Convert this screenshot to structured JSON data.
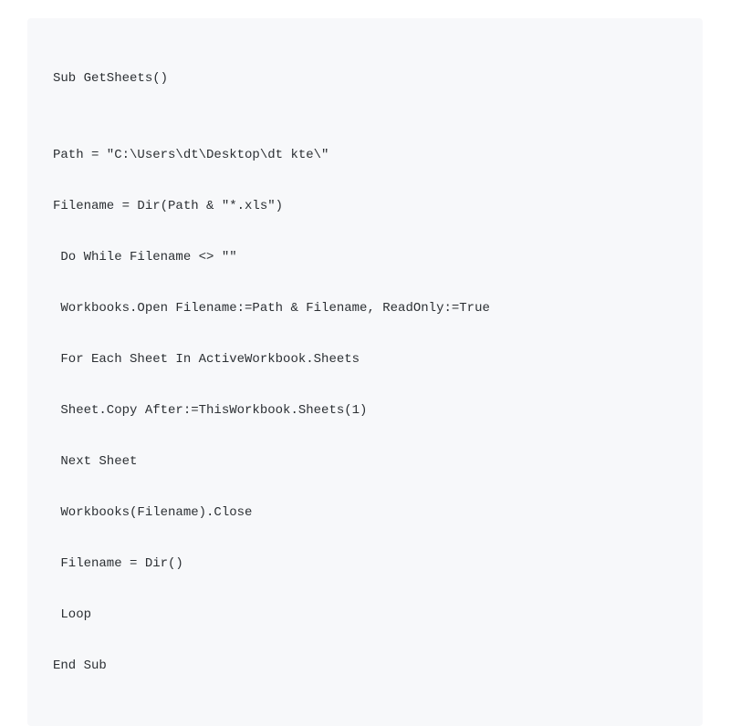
{
  "code": {
    "lines": [
      "Sub GetSheets()",
      "",
      "Path = \"C:\\Users\\dt\\Desktop\\dt kte\\\"",
      "Filename = Dir(Path & \"*.xls\")",
      " Do While Filename <> \"\"",
      " Workbooks.Open Filename:=Path & Filename, ReadOnly:=True",
      " For Each Sheet In ActiveWorkbook.Sheets",
      " Sheet.Copy After:=ThisWorkbook.Sheets(1)",
      " Next Sheet",
      " Workbooks(Filename).Close",
      " Filename = Dir()",
      " Loop",
      "End Sub"
    ]
  }
}
